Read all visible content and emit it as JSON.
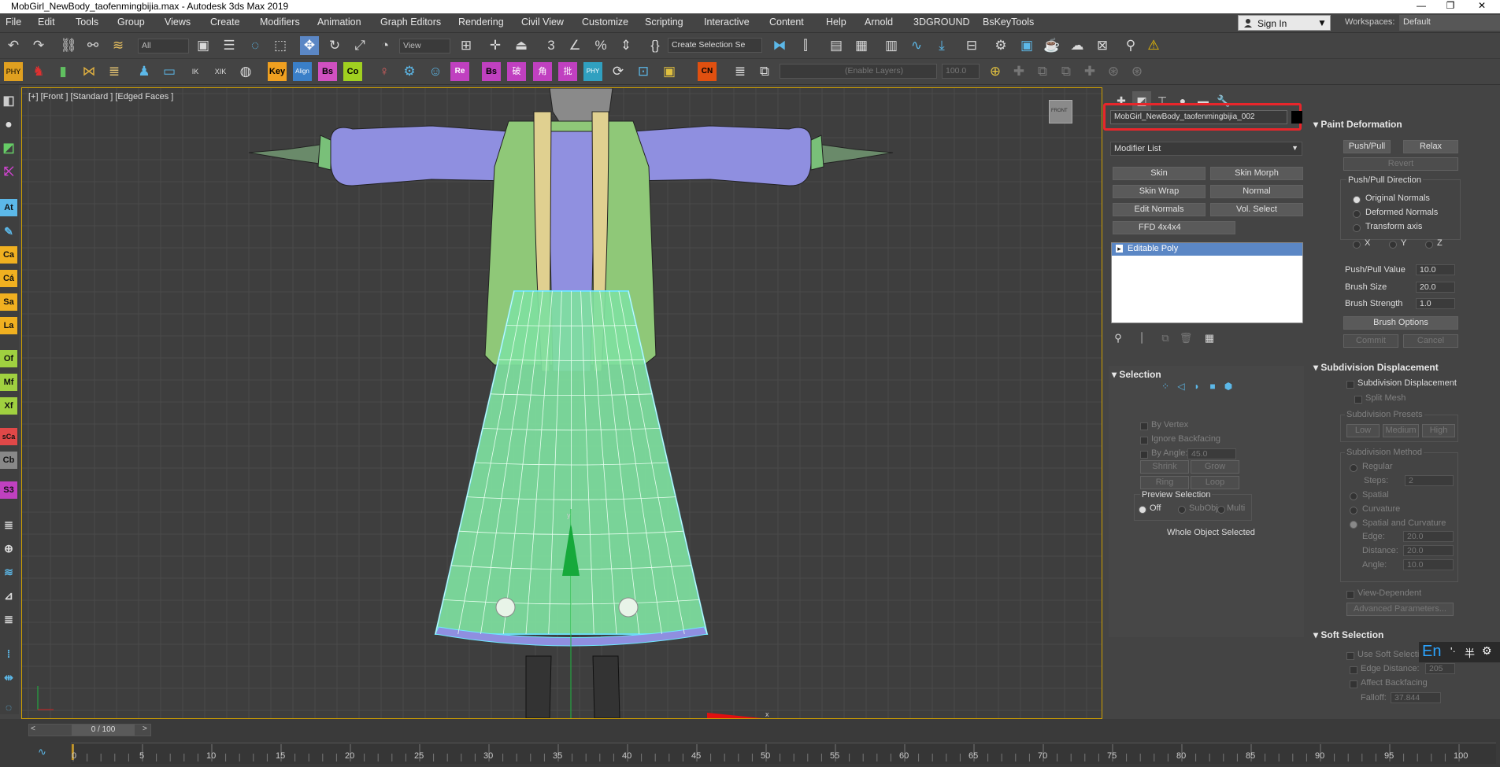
{
  "window": {
    "title": "MobGirl_NewBody_taofenmingbijia.max - Autodesk 3ds Max 2019",
    "min": "—",
    "restore": "❐",
    "close": "✕"
  },
  "menu": [
    "File",
    "Edit",
    "Tools",
    "Group",
    "Views",
    "Create",
    "Modifiers",
    "Animation",
    "Graph Editors",
    "Rendering",
    "Civil View",
    "Customize",
    "Scripting",
    "Interactive",
    "Content",
    "Help",
    "Arnold",
    "3DGROUND",
    "BsKeyTools"
  ],
  "signin": {
    "label": "Sign In"
  },
  "workspaces": {
    "label": "Workspaces:",
    "value": "Default"
  },
  "toolbar1": {
    "selection_filter": "All",
    "ref_coord": "View",
    "named_selection": "Create Selection Se"
  },
  "toolbar2": {
    "icons": [
      "PHY",
      "Key",
      "Align",
      "Bs",
      "Co",
      "Re",
      "Bs",
      "破",
      "角",
      "批",
      "PHY",
      "CN"
    ],
    "layer_dropdown": "(Enable Layers)",
    "layer_value": "100.0"
  },
  "left_toolbar": [
    "At",
    "Ca",
    "Cá",
    "Sa",
    "La",
    "Of",
    "Mf",
    "Xf",
    "sCa",
    "Cb",
    "S3"
  ],
  "viewport": {
    "label": "[+] [Front ] [Standard ] [Edged Faces ]",
    "viewcube": "FRONT",
    "axis_y": "y",
    "axis_x": "x"
  },
  "command_panel": {
    "object_name": "MobGirl_NewBody_taofenmingbijia_002",
    "modifier_list": "Modifier List",
    "buttons": [
      "Skin",
      "Skin Morph",
      "Skin Wrap",
      "Normal",
      "Edit Normals",
      "Vol. Select",
      "FFD 4x4x4"
    ],
    "stack_item": "Editable Poly",
    "selection": {
      "header": "Selection",
      "by_vertex": "By Vertex",
      "ignore_backfacing": "Ignore Backfacing",
      "by_angle": "By Angle:",
      "by_angle_value": "45.0",
      "shrink": "Shrink",
      "grow": "Grow",
      "ring": "Ring",
      "loop": "Loop",
      "preview_selection": "Preview Selection",
      "off": "Off",
      "subobj": "SubObj",
      "multi": "Multi",
      "status": "Whole Object Selected"
    }
  },
  "paint_deformation": {
    "header": "Paint Deformation",
    "push_pull": "Push/Pull",
    "relax": "Relax",
    "revert": "Revert",
    "direction_title": "Push/Pull Direction",
    "original_normals": "Original Normals",
    "deformed_normals": "Deformed Normals",
    "transform_axis": "Transform axis",
    "x": "X",
    "y": "Y",
    "z": "Z",
    "push_pull_value_label": "Push/Pull Value",
    "push_pull_value": "10.0",
    "brush_size_label": "Brush Size",
    "brush_size": "20.0",
    "brush_strength_label": "Brush Strength",
    "brush_strength": "1.0",
    "brush_options": "Brush Options",
    "commit": "Commit",
    "cancel": "Cancel"
  },
  "subdivision_displacement": {
    "header": "Subdivision Displacement",
    "checkbox": "Subdivision Displacement",
    "split_mesh": "Split Mesh",
    "presets_title": "Subdivision Presets",
    "low": "Low",
    "medium": "Medium",
    "high": "High",
    "method_title": "Subdivision Method",
    "regular": "Regular",
    "steps_label": "Steps:",
    "steps": "2",
    "spatial": "Spatial",
    "curvature": "Curvature",
    "spatial_curvature": "Spatial and Curvature",
    "edge_label": "Edge:",
    "edge": "20.0",
    "distance_label": "Distance:",
    "distance": "20.0",
    "angle_label": "Angle:",
    "angle": "10.0",
    "view_dependent": "View-Dependent",
    "advanced": "Advanced Parameters..."
  },
  "soft_selection": {
    "header": "Soft Selection",
    "use_soft": "Use Soft Selectio",
    "edge_distance_label": "Edge Distance:",
    "edge_distance": "205",
    "affect_backfacing": "Affect Backfacing",
    "falloff_label": "Falloff:",
    "falloff": "37.844"
  },
  "ime": {
    "lang": "En",
    "dot": "'·",
    "sym": "半"
  },
  "timeline": {
    "frame": "0 / 100",
    "prev": "<",
    "next": ">",
    "ticks": [
      "0",
      "5",
      "10",
      "15",
      "20",
      "25",
      "30",
      "35",
      "40",
      "45",
      "50",
      "55",
      "60",
      "65",
      "70",
      "75",
      "80",
      "85",
      "90",
      "95",
      "100"
    ]
  },
  "colors": {
    "accent": "#5b87c5",
    "highlight_red": "#e8262b",
    "viewport_border": "#d0a000",
    "skirt": "#7fe0a0",
    "sleeve": "#8f8fe0"
  }
}
